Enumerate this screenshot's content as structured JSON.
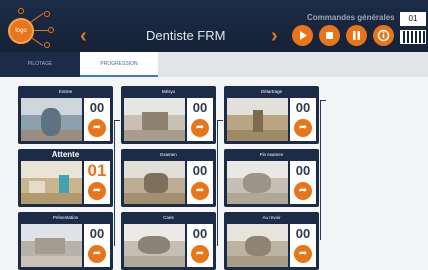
{
  "header": {
    "logo_text": "logo",
    "title": "Dentiste FRM",
    "commands_label": "Commandes générales",
    "counter": "01"
  },
  "tabs": [
    "PILOTAGE",
    "PROGRESSION"
  ],
  "cards": [
    {
      "title": "Entree",
      "count": "00"
    },
    {
      "title": "Attente",
      "count": "01"
    },
    {
      "title": "Présentation",
      "count": "00"
    },
    {
      "title": "Mésyo",
      "count": "00"
    },
    {
      "title": "Examen",
      "count": "00"
    },
    {
      "title": "Carie",
      "count": "00"
    },
    {
      "title": "Détartrage",
      "count": "00"
    },
    {
      "title": "Fin examen",
      "count": "00"
    },
    {
      "title": "Au revoir",
      "count": "00"
    }
  ],
  "theme": {
    "accent": "#e8751a",
    "navy": "#1c2b47",
    "link": "#3a7bd5"
  }
}
